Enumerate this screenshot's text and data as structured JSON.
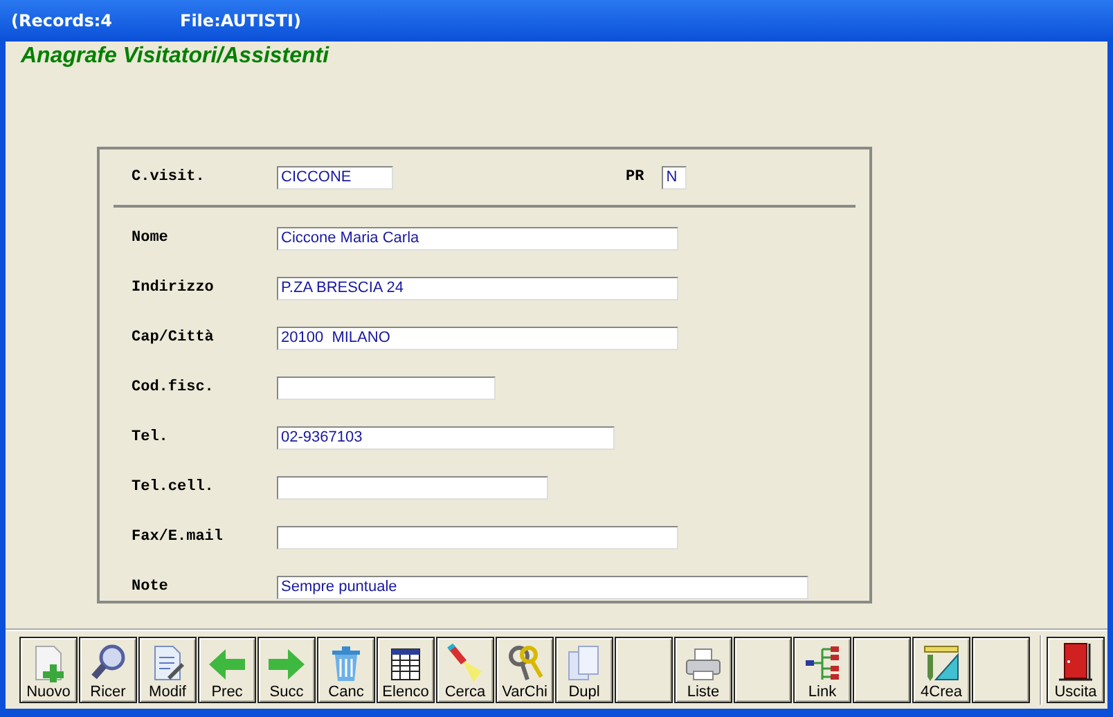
{
  "window": {
    "title_left": "(Records:4",
    "title_right": "File:AUTISTI)"
  },
  "heading": "Anagrafe Visitatori/Assistenti",
  "header_fields": [
    {
      "label": "C.visit.",
      "value": "CICCONE"
    },
    {
      "label": "PR",
      "value": "N"
    }
  ],
  "fields": [
    {
      "label": "Nome",
      "value": "Ciccone Maria Carla"
    },
    {
      "label": "Indirizzo",
      "value": "P.ZA BRESCIA 24"
    },
    {
      "label": "Cap/Città",
      "value": "20100  MILANO"
    },
    {
      "label": "Cod.fisc."
    },
    {
      "label": "Tel.",
      "value": "02-9367103"
    },
    {
      "label": "Tel.cell."
    },
    {
      "label": "Fax/E.mail"
    },
    {
      "label": "Note",
      "value": "Sempre puntuale"
    }
  ],
  "toolbar": [
    {
      "kind": "new",
      "label": "Nuovo"
    },
    {
      "kind": "search",
      "label": "Ricer"
    },
    {
      "kind": "edit",
      "label": "Modif"
    },
    {
      "kind": "prev",
      "label": "Prec"
    },
    {
      "kind": "next",
      "label": "Succ"
    },
    {
      "kind": "delete",
      "label": "Canc"
    },
    {
      "kind": "list",
      "label": "Elenco"
    },
    {
      "kind": "find",
      "label": "Cerca"
    },
    {
      "kind": "keys",
      "label": "VarChi"
    },
    {
      "kind": "copy",
      "label": "Dupl"
    },
    {
      "kind": "blank"
    },
    {
      "kind": "print",
      "label": "Liste"
    },
    {
      "kind": "blank"
    },
    {
      "kind": "link",
      "label": "Link"
    },
    {
      "kind": "blank"
    },
    {
      "kind": "tools",
      "label": "4Crea"
    },
    {
      "kind": "blank"
    },
    {
      "kind": "exit",
      "label": "Uscita"
    }
  ]
}
